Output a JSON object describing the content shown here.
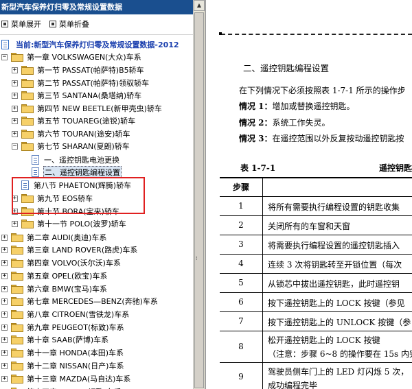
{
  "window": {
    "title": "新型汽车保养灯归零及常规设置数据"
  },
  "toolbar": {
    "expand_label": "菜单展开",
    "collapse_label": "菜单折叠"
  },
  "tree": {
    "root": "当前:新型汽车保养灯归零及常规设置数据-2012",
    "items": [
      {
        "label": "第一章 VOLKSWAGEN(大众)车系",
        "type": "folder",
        "expander": "−"
      },
      {
        "label": "第一节 PASSAT(帕萨特)B5轿车",
        "type": "folder",
        "expander": "+"
      },
      {
        "label": "第二节 PASSAT(帕萨特)领驭轿车",
        "type": "folder",
        "expander": "+"
      },
      {
        "label": "第三节 SANTANA(桑塔纳)轿车",
        "type": "folder",
        "expander": "+"
      },
      {
        "label": "第四节 NEW BEETLE(新甲壳虫)轿车",
        "type": "folder",
        "expander": "+"
      },
      {
        "label": "第五节 TOUAREG(途锐)轿车",
        "type": "folder",
        "expander": "+"
      },
      {
        "label": "第六节 TOURAN(途安)轿车",
        "type": "folder",
        "expander": "+"
      },
      {
        "label": "第七节 SHARAN(夏朗)轿车",
        "type": "folder",
        "expander": "−"
      },
      {
        "label": "一、遥控钥匙电池更换",
        "type": "doc",
        "expander": ""
      },
      {
        "label": "二、遥控钥匙编程设置",
        "type": "doc",
        "expander": ""
      },
      {
        "label": "第八节 PHAETON(辉腾)轿车",
        "type": "doc",
        "expander": ""
      },
      {
        "label": "第九节 EOS轿车",
        "type": "folder",
        "expander": "+"
      },
      {
        "label": "第十节 BORA(宝来)轿车",
        "type": "folder",
        "expander": "+"
      },
      {
        "label": "第十一节 POLO(波罗)轿车",
        "type": "folder",
        "expander": "+"
      },
      {
        "label": "第二章 AUDI(奥迪)车系",
        "type": "folder",
        "expander": "+"
      },
      {
        "label": "第三章 LAND ROVER(路虎)车系",
        "type": "folder",
        "expander": "+"
      },
      {
        "label": "第四章 VOLVO(沃尔沃)车系",
        "type": "folder",
        "expander": "+"
      },
      {
        "label": "第五章 OPEL(欧宝)车系",
        "type": "folder",
        "expander": "+"
      },
      {
        "label": "第六章 BMW(宝马)车系",
        "type": "folder",
        "expander": "+"
      },
      {
        "label": "第七章 MERCEDES—BENZ(奔驰)车系",
        "type": "folder",
        "expander": "+"
      },
      {
        "label": "第八章 CITROEN(雪铁龙)车系",
        "type": "folder",
        "expander": "+"
      },
      {
        "label": "第九章 PEUGEOT(标致)车系",
        "type": "folder",
        "expander": "+"
      },
      {
        "label": "第十章 SAAB(萨博)车系",
        "type": "folder",
        "expander": "+"
      },
      {
        "label": "第十一章 HONDA(本田)车系",
        "type": "folder",
        "expander": "+"
      },
      {
        "label": "第十二章 NISSAN(日产)车系",
        "type": "folder",
        "expander": "+"
      },
      {
        "label": "第十三章 MAZDA(马自达)车系",
        "type": "folder",
        "expander": "+"
      },
      {
        "label": "第十四章 ACURA(讴歌)车系",
        "type": "folder",
        "expander": "+"
      }
    ]
  },
  "document": {
    "heading": "二、遥控钥匙编程设置",
    "intro": "在下列情况下必须按照表 1-7-1 所示的操作步",
    "cases": [
      {
        "label": "情况 1：",
        "text": "增加或替换遥控钥匙。"
      },
      {
        "label": "情况 2：",
        "text": "系统工作失灵。"
      },
      {
        "label": "情况 3：",
        "text": "在遥控范围以外反复按动遥控钥匙按"
      }
    ],
    "table_id": "表 1-7-1",
    "table_title": "遥控钥匙",
    "col_step": "步骤",
    "rows": [
      {
        "step": "1",
        "text": "将所有需要执行编程设置的钥匙收集"
      },
      {
        "step": "2",
        "text": "关闭所有的车窗和天窗"
      },
      {
        "step": "3",
        "text": "将需要执行编程设置的遥控钥匙插入"
      },
      {
        "step": "4",
        "text": "连续 3 次将钥匙转至开锁位置（每次"
      },
      {
        "step": "5",
        "text": "从锁芯中拔出遥控钥匙，此时遥控钥"
      },
      {
        "step": "6",
        "text": "按下遥控钥匙上的 LOCK 按键（参见"
      },
      {
        "step": "7",
        "text": "按下遥控钥匙上的 UNLOCK 按键（参"
      },
      {
        "step": "8",
        "text": "松开遥控钥匙上的 LOCK 按键",
        "text2": "（注意：步骤 6~8 的操作要在 15s 内完"
      },
      {
        "step": "9",
        "text": "驾驶员侧车门上的 LED 灯闪烁 5 次，",
        "text2": "成功编程完毕"
      }
    ]
  },
  "colors": {
    "titlebar": "#1a4f8f",
    "highlight": "#e02020",
    "root_text": "#1a3fae"
  }
}
